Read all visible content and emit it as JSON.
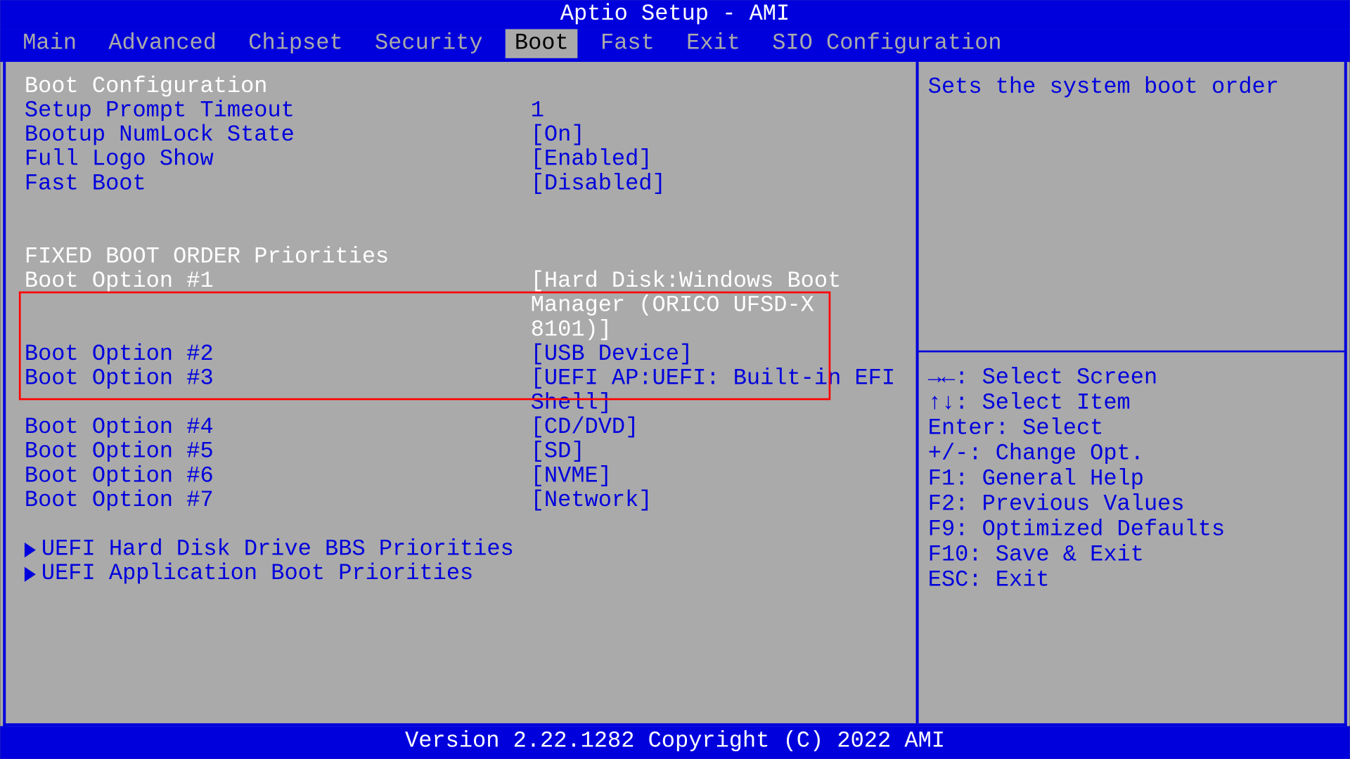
{
  "title": "Aptio Setup - AMI",
  "tabs": [
    "Main",
    "Advanced",
    "Chipset",
    "Security",
    "Boot",
    "Fast",
    "Exit",
    "SIO Configuration"
  ],
  "active_tab_index": 4,
  "sections": {
    "boot_config_title": "Boot Configuration",
    "items": [
      {
        "label": "Setup Prompt Timeout",
        "value": "1"
      },
      {
        "label": "Bootup NumLock State",
        "value": "[On]"
      },
      {
        "label": "Full Logo Show",
        "value": "[Enabled]"
      },
      {
        "label": "Fast Boot",
        "value": "[Disabled]"
      }
    ],
    "fixed_order_title": "FIXED BOOT ORDER Priorities",
    "boot_opts": [
      {
        "label": "Boot Option #1",
        "value": "[Hard Disk:Windows Boot Manager (ORICO UFSD-X 8101)]",
        "selected": true
      },
      {
        "label": "Boot Option #2",
        "value": "[USB Device]"
      },
      {
        "label": "Boot Option #3",
        "value": "[UEFI AP:UEFI: Built-in EFI Shell]"
      },
      {
        "label": "Boot Option #4",
        "value": "[CD/DVD]"
      },
      {
        "label": "Boot Option #5",
        "value": "[SD]"
      },
      {
        "label": "Boot Option #6",
        "value": "[NVME]"
      },
      {
        "label": "Boot Option #7",
        "value": "[Network]"
      }
    ],
    "submenus": [
      "UEFI Hard Disk Drive BBS Priorities",
      "UEFI Application Boot Priorities"
    ]
  },
  "help_text": "Sets the system boot order",
  "keyhelp": [
    "→←: Select Screen",
    "↑↓: Select Item",
    "Enter: Select",
    "+/-: Change Opt.",
    "F1: General Help",
    "F2: Previous Values",
    "F9: Optimized Defaults",
    "F10: Save & Exit",
    "ESC: Exit"
  ],
  "footer": "Version 2.22.1282 Copyright (C) 2022 AMI"
}
